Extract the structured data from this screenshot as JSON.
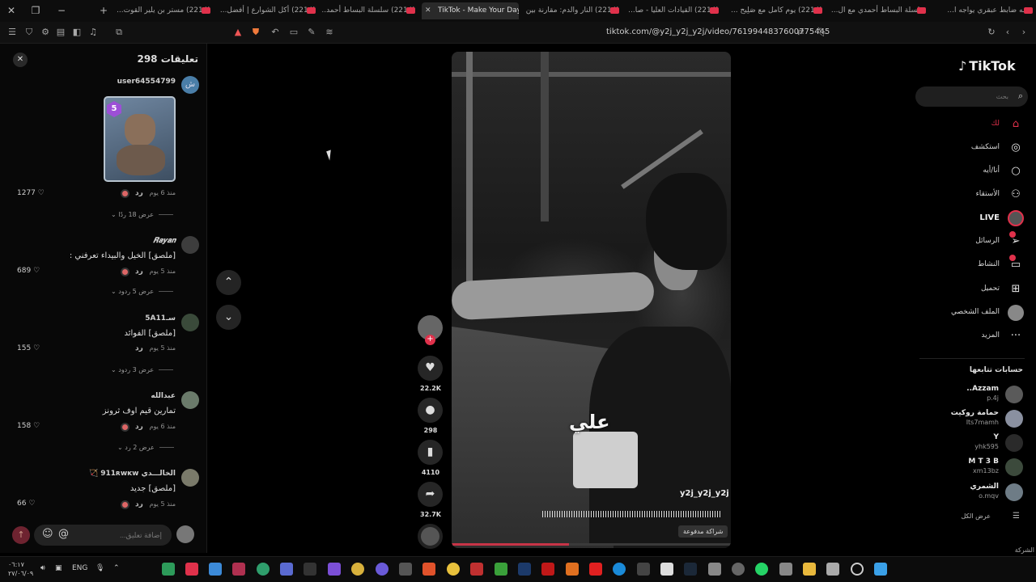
{
  "tabs": [
    {
      "title": "قصه ضابط عبقري يواجه ا..."
    },
    {
      "title": "سلسلة البساط أحمدي مع ال..."
    },
    {
      "title": "(2214) يوم كامل مع صَلِيح ..."
    },
    {
      "title": "(2214) القيادات العليا - صا..."
    },
    {
      "title": "(2214) النار والدم: مقارنة بين..."
    },
    {
      "title": "TikTok - Make Your Day",
      "active": true
    },
    {
      "title": "(2214) سلسلة البساط أحمد..."
    },
    {
      "title": "(2214) أكل الشوارع | أفضل..."
    },
    {
      "title": "(2214) مستر بن يلير القوت..."
    }
  ],
  "address_bar": {
    "url": "tiktok.com/@y2j_y2j_y2j/video/7619944837600775445"
  },
  "comments": {
    "title": "تعليقات 298",
    "close_icon": "close-icon",
    "items": [
      {
        "user": "user64554799",
        "avatar_letter": "ش",
        "text": "",
        "sticker": true,
        "sticker_badge": "5",
        "time": "منذ 6 يوم",
        "reply": "رد",
        "likes": "1277",
        "replies": "عرض 18 ردًا"
      },
      {
        "user": "𝑹𝒂𝒚𝒂𝒏",
        "text": "[ملصق] الخيل والبيداء تعرفني :",
        "time": "منذ 5 يوم",
        "reply": "رد",
        "likes": "689",
        "replies": "عرض 5 ردود"
      },
      {
        "user": "سـ5A11",
        "text": "[ملصق] الفوائد",
        "time": "منذ 5 يوم",
        "reply": "رد",
        "likes": "155",
        "replies": "عرض 3 ردود"
      },
      {
        "user": "عبدالله",
        "text": "تمارين قيم اوف ثرونز",
        "time": "منذ 6 يوم",
        "reply": "رد",
        "likes": "158",
        "replies": "عرض 2 رد"
      },
      {
        "user": "الخالـــدي 911ʀᴡᴋᴡ 🏹",
        "text": "[ملصق] جديد",
        "time": "منذ 5 يوم",
        "reply": "رد",
        "likes": "66",
        "replies": ""
      }
    ],
    "input_placeholder": "إضافة تعليق...",
    "emoji_icon": "emoji-icon",
    "mention_icon": "at-icon",
    "post_icon": "arrow-up-icon"
  },
  "video": {
    "caption": "علي",
    "watermark": "y2j_y2j_y2j",
    "paid_badge": "شراكة مدفوعة",
    "progress": 0.42
  },
  "actions": {
    "likes": "22.2K",
    "comments": "298",
    "saves": "4110",
    "shares": "32.7K"
  },
  "sidebar": {
    "logo": "TikTok",
    "search_placeholder": "بحث",
    "nav": [
      {
        "key": "home",
        "label": "لك",
        "icon": "home-icon"
      },
      {
        "key": "explore",
        "label": "استكشف",
        "icon": "compass-icon"
      },
      {
        "key": "ai-self",
        "label": "أنا/أيه",
        "icon": "circle-icon"
      },
      {
        "key": "following",
        "label": "الأستقاء",
        "icon": "people-icon"
      },
      {
        "key": "live",
        "label": "LIVE",
        "icon": "live-icon"
      },
      {
        "key": "messages",
        "label": "الرسائل",
        "icon": "send-icon",
        "badge": true
      },
      {
        "key": "activity",
        "label": "النشاط",
        "icon": "chat-icon",
        "badge": true
      },
      {
        "key": "upload",
        "label": "تحميل",
        "icon": "plus-square-icon"
      },
      {
        "key": "profile",
        "label": "الملف الشخصي",
        "icon": "avatar-icon"
      },
      {
        "key": "more",
        "label": "المزيد",
        "icon": "more-icon"
      }
    ],
    "following_title": "حسابات تتابعها",
    "following": [
      {
        "name": "Azzam..",
        "handle": "p.4j"
      },
      {
        "name": "حمامة روكيت",
        "handle": "Its7mamh"
      },
      {
        "name": "Y",
        "handle": "yhk595"
      },
      {
        "name": "M T 3 B",
        "handle": "xm13bz"
      },
      {
        "name": "الشمري",
        "handle": "o.mqv"
      }
    ],
    "see_all": "عرض الكل",
    "company": "الشركة"
  },
  "taskbar": {
    "time": "٠٦:١٧",
    "date": "٢٧/٠٦/٠٩",
    "language": "ENG"
  },
  "colors": {
    "accent": "#e0314b",
    "background": "#000000",
    "panel": "#080808"
  }
}
